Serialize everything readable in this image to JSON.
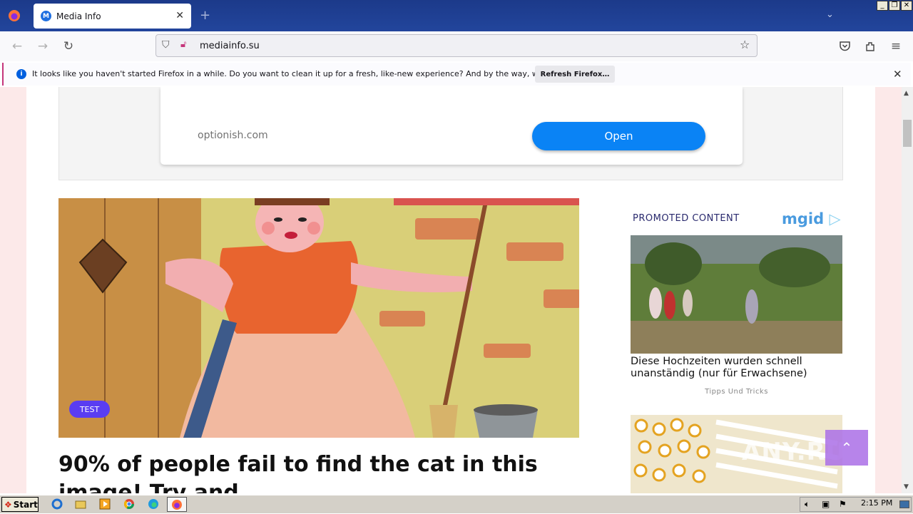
{
  "window": {
    "tab_title": "M",
    "tab_label": "Media Info",
    "tab_favicon": "M",
    "controls": [
      "_",
      "❐",
      "✕"
    ]
  },
  "navbar": {
    "url": "mediainfo.su"
  },
  "notification": {
    "info_glyph": "i",
    "message": "It looks like you haven't started Firefox in a while. Do you want to clean it up for a fresh, like-new experience? And by the way, welcome back!",
    "button_label": "Refresh Firefox…"
  },
  "ad": {
    "domain": "optionish.com",
    "button_label": "Open"
  },
  "article": {
    "tag": "TEST",
    "headline": "90% of people fail to find the cat in this image! Try and"
  },
  "sidebar": {
    "promo_label": "PROMOTED CONTENT",
    "logo": "mgid",
    "items": [
      {
        "title": "Diese Hochzeiten wurden schnell unanständig (nur für Erwachsene)",
        "source": "Tipps Und Tricks"
      }
    ]
  },
  "watermark": "ANY.RUN",
  "taskbar": {
    "start_label": "Start",
    "clock": "2:15 PM"
  },
  "colors": {
    "tabbar": "#1c3a8a",
    "ad_button": "#0a83f5",
    "tag": "#5a3df2",
    "page_background": "#fce9e9"
  }
}
